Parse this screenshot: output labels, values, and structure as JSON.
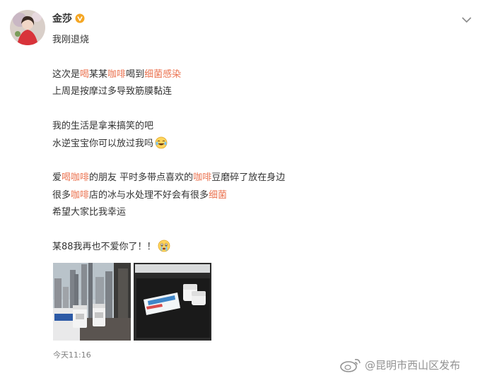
{
  "post": {
    "author": "金莎",
    "tagline": "我刚退烧",
    "lines": [
      {
        "segments": [
          {
            "text": "这次是"
          },
          {
            "text": "喝",
            "kw": true
          },
          {
            "text": "某某"
          },
          {
            "text": "咖啡",
            "kw": true
          },
          {
            "text": "喝到"
          },
          {
            "text": "细菌",
            "kw": true
          },
          {
            "text": "感染",
            "kw": true
          }
        ]
      },
      {
        "segments": [
          {
            "text": "上周是按摩过多导致筋膜黏连"
          }
        ]
      },
      {
        "gap": true
      },
      {
        "segments": [
          {
            "text": "我的生活是拿来搞笑的吧"
          }
        ]
      },
      {
        "segments": [
          {
            "text": "水逆宝宝你可以放过我吗"
          }
        ],
        "emoji": "laugh-cry"
      },
      {
        "gap": true
      },
      {
        "segments": [
          {
            "text": "爱"
          },
          {
            "text": "喝",
            "kw": true
          },
          {
            "text": "咖啡",
            "kw": true
          },
          {
            "text": "的朋友 平时多带点喜欢的"
          },
          {
            "text": "咖啡",
            "kw": true
          },
          {
            "text": "豆磨碎了放在身边"
          }
        ]
      },
      {
        "segments": [
          {
            "text": "很多"
          },
          {
            "text": "咖啡",
            "kw": true
          },
          {
            "text": "店的冰与水处理不好会有很多"
          },
          {
            "text": "细菌",
            "kw": true
          }
        ]
      },
      {
        "segments": [
          {
            "text": "希望大家比我幸运"
          }
        ]
      },
      {
        "gap": true
      },
      {
        "segments": [
          {
            "text": "某88我再也不爱你了！！"
          }
        ],
        "emoji": "crying"
      }
    ],
    "timestamp": "今天11:16"
  },
  "watermark": {
    "text": "@昆明市西山区发布"
  },
  "colors": {
    "keyword": "#eb7350",
    "text": "#333333",
    "meta": "#808080",
    "verified": "#f5a623"
  },
  "icons": {
    "verified": "verified-badge-icon",
    "menu": "chevron-down-icon"
  }
}
